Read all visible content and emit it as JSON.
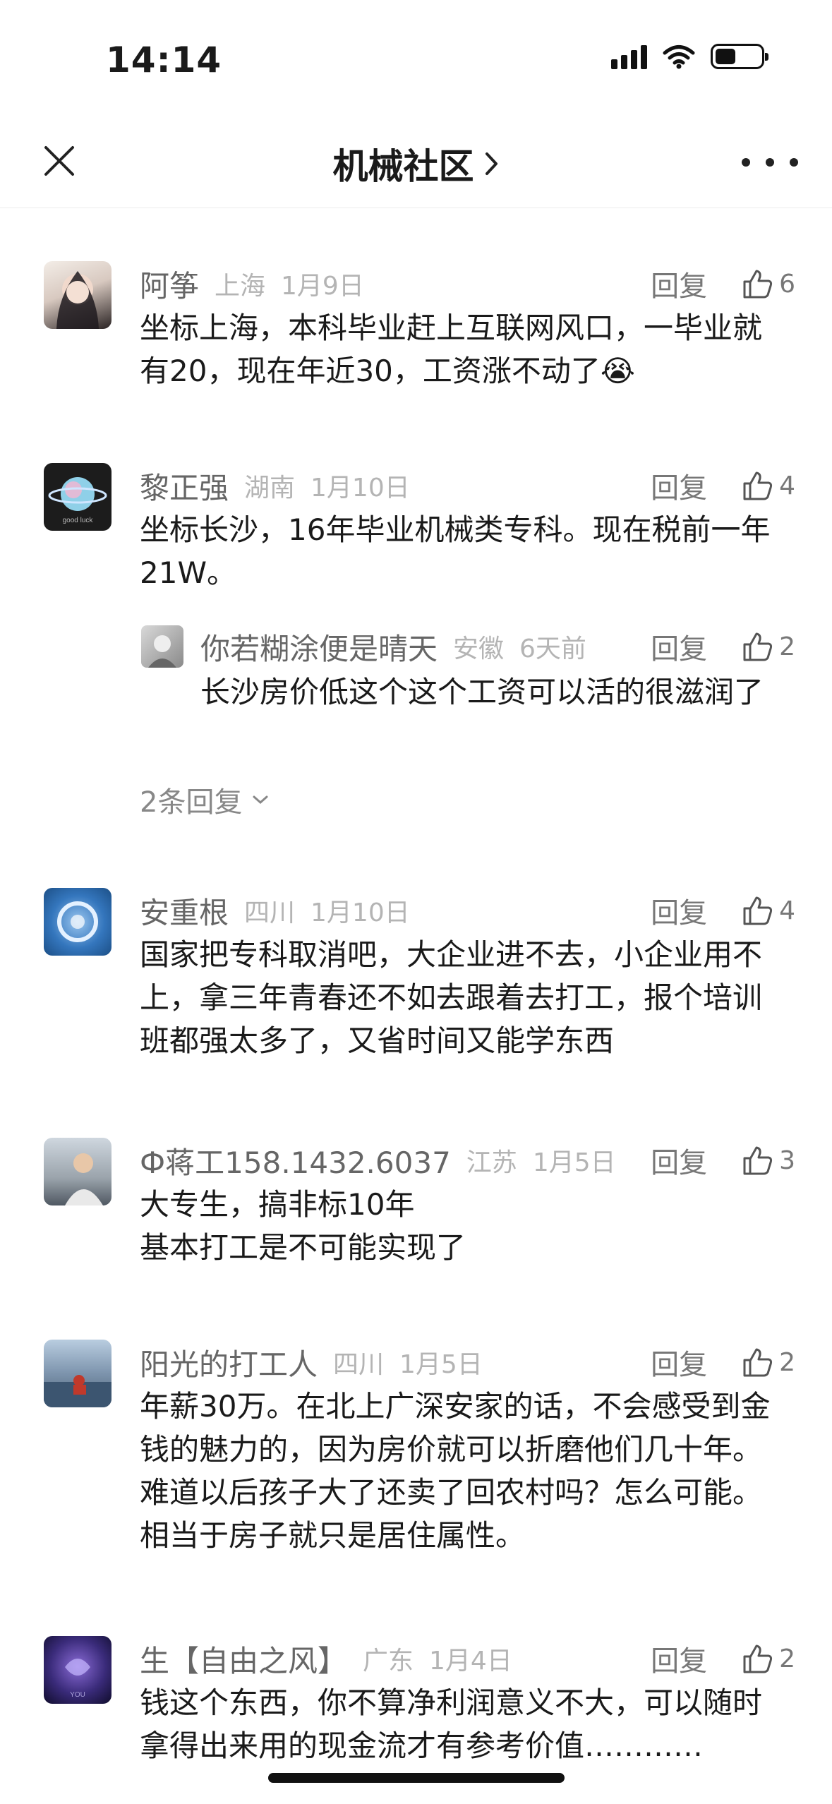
{
  "status_bar": {
    "time": "14:14"
  },
  "nav": {
    "title": "机械社区",
    "title_chevron": "›"
  },
  "comments": [
    {
      "name": "阿筝",
      "location": "上海",
      "date": "1月9日",
      "reply": "回复",
      "likes": "6",
      "text": "坐标上海，本科毕业赶上互联网风口，一毕业就有20，现在年近30，工资涨不动了😭"
    },
    {
      "name": "黎正强",
      "location": "湖南",
      "date": "1月10日",
      "reply": "回复",
      "likes": "4",
      "text": "坐标长沙，16年毕业机械类专科。现在税前一年21W。",
      "sub_reply": {
        "name": "你若糊涂便是晴天",
        "location": "安徽",
        "date": "6天前",
        "reply": "回复",
        "likes": "2",
        "text": "长沙房价低这个这个工资可以活的很滋润了"
      },
      "more_replies": "2条回复"
    },
    {
      "name": "安重根",
      "location": "四川",
      "date": "1月10日",
      "reply": "回复",
      "likes": "4",
      "text": "国家把专科取消吧，大企业进不去，小企业用不上，拿三年青春还不如去跟着去打工，报个培训班都强太多了，又省时间又能学东西"
    },
    {
      "name": "Ф蒋工158.1432.6037",
      "location": "江苏",
      "date": "1月5日",
      "reply": "回复",
      "likes": "3",
      "text_lines": [
        "大专生，搞非标10年",
        "基本打工是不可能实现了"
      ]
    },
    {
      "name": "阳光的打工人",
      "location": "四川",
      "date": "1月5日",
      "reply": "回复",
      "likes": "2",
      "text": "年薪30万。在北上广深安家的话，不会感受到金钱的魅力的，因为房价就可以折磨他们几十年。难道以后孩子大了还卖了回农村吗？怎么可能。相当于房子就只是居住属性。"
    },
    {
      "name": "生【自由之风】",
      "location": "广东",
      "date": "1月4日",
      "reply": "回复",
      "likes": "2",
      "text": "钱这个东西，你不算净利润意义不大，可以随时拿得出来用的现金流才有参考价值…………"
    }
  ],
  "icons": {
    "close": "close-icon",
    "more": "more-dots-icon",
    "like": "thumb-up-icon",
    "chevron": "chevron-down-icon",
    "signal": "cellular-signal-icon",
    "wifi": "wifi-icon",
    "battery": "battery-icon"
  },
  "colors": {
    "text": "#1a1a1a",
    "meta": "#b4b4b4",
    "secondary": "#777777"
  }
}
